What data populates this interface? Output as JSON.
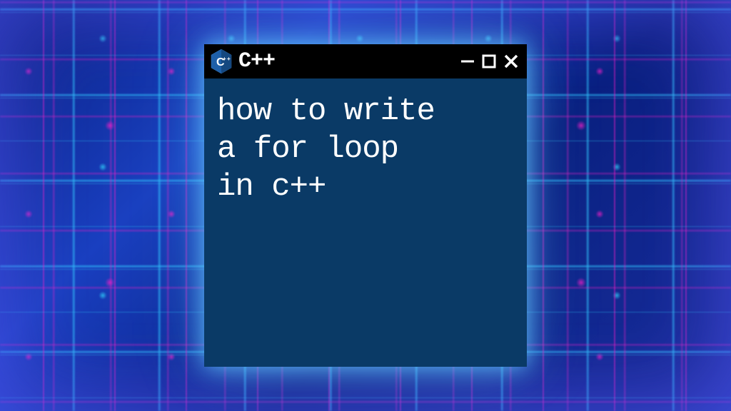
{
  "window": {
    "title": "C++",
    "icon": "cpp-icon",
    "body_text": "how to write\na for loop\nin c++"
  },
  "colors": {
    "titlebar_bg": "#000000",
    "body_bg": "#0a3a66",
    "text": "#ffffff",
    "glow": "#64c8ff",
    "accent_pink": "#ff1ec8",
    "accent_cyan": "#32dcff",
    "icon_blue": "#1e5fa8"
  }
}
